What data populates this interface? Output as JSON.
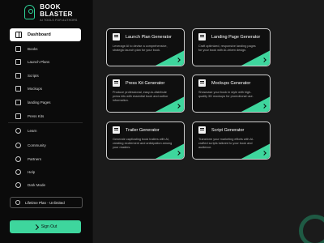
{
  "brand": {
    "title": "BOOK BLASTER",
    "subtitle": "AI TOOLS FOR AUTHORS",
    "accent": "#3ed69d"
  },
  "sidebar": {
    "active": {
      "label": "Dashboard",
      "icon": "dashboard-icon"
    },
    "items": [
      {
        "label": "Books",
        "icon": "book-icon"
      },
      {
        "label": "Launch Plans",
        "icon": "rocket-icon"
      },
      {
        "label": "Scripts",
        "icon": "script-icon"
      },
      {
        "label": "Mockups",
        "icon": "image-icon"
      },
      {
        "label": "landing Pages",
        "icon": "page-icon"
      },
      {
        "label": "Press Kits",
        "icon": "press-icon"
      }
    ],
    "secondary": [
      {
        "label": "Learn",
        "icon": "learn-icon"
      },
      {
        "label": "Community",
        "icon": "community-icon"
      },
      {
        "label": "Partners",
        "icon": "partners-icon"
      },
      {
        "label": "Help",
        "icon": "help-icon"
      },
      {
        "label": "Dark Mode",
        "icon": "moon-icon"
      }
    ],
    "plan": "Lifetime Plan - Unlimited",
    "signout": "Sign Out"
  },
  "cards": [
    {
      "title": "Launch Plan Generator",
      "desc": "Leverage AI to devise a comprehensive, strategic launch plan for your book.",
      "icon": "launch-plan-icon"
    },
    {
      "title": "Landing Page Generator",
      "desc": "Craft optimized, responsive landing pages for your book with AI-driven design.",
      "icon": "landing-page-icon"
    },
    {
      "title": "Press Kit Generator",
      "desc": "Produce professional, easy-to-distribute press kits with essential book and author information.",
      "icon": "press-kit-icon"
    },
    {
      "title": "Mockups Generator",
      "desc": "Showcase your book in style with high-quality 3D mockups for promotional use.",
      "icon": "mockups-icon"
    },
    {
      "title": "Trailer Generator",
      "desc": "Generate captivating book trailers with AI, creating excitement and anticipation among your readers.",
      "icon": "trailer-icon"
    },
    {
      "title": "Script Generator",
      "desc": "Transform your marketing efforts with AI-crafted scripts tailored to your book and audience.",
      "icon": "script-icon"
    }
  ]
}
